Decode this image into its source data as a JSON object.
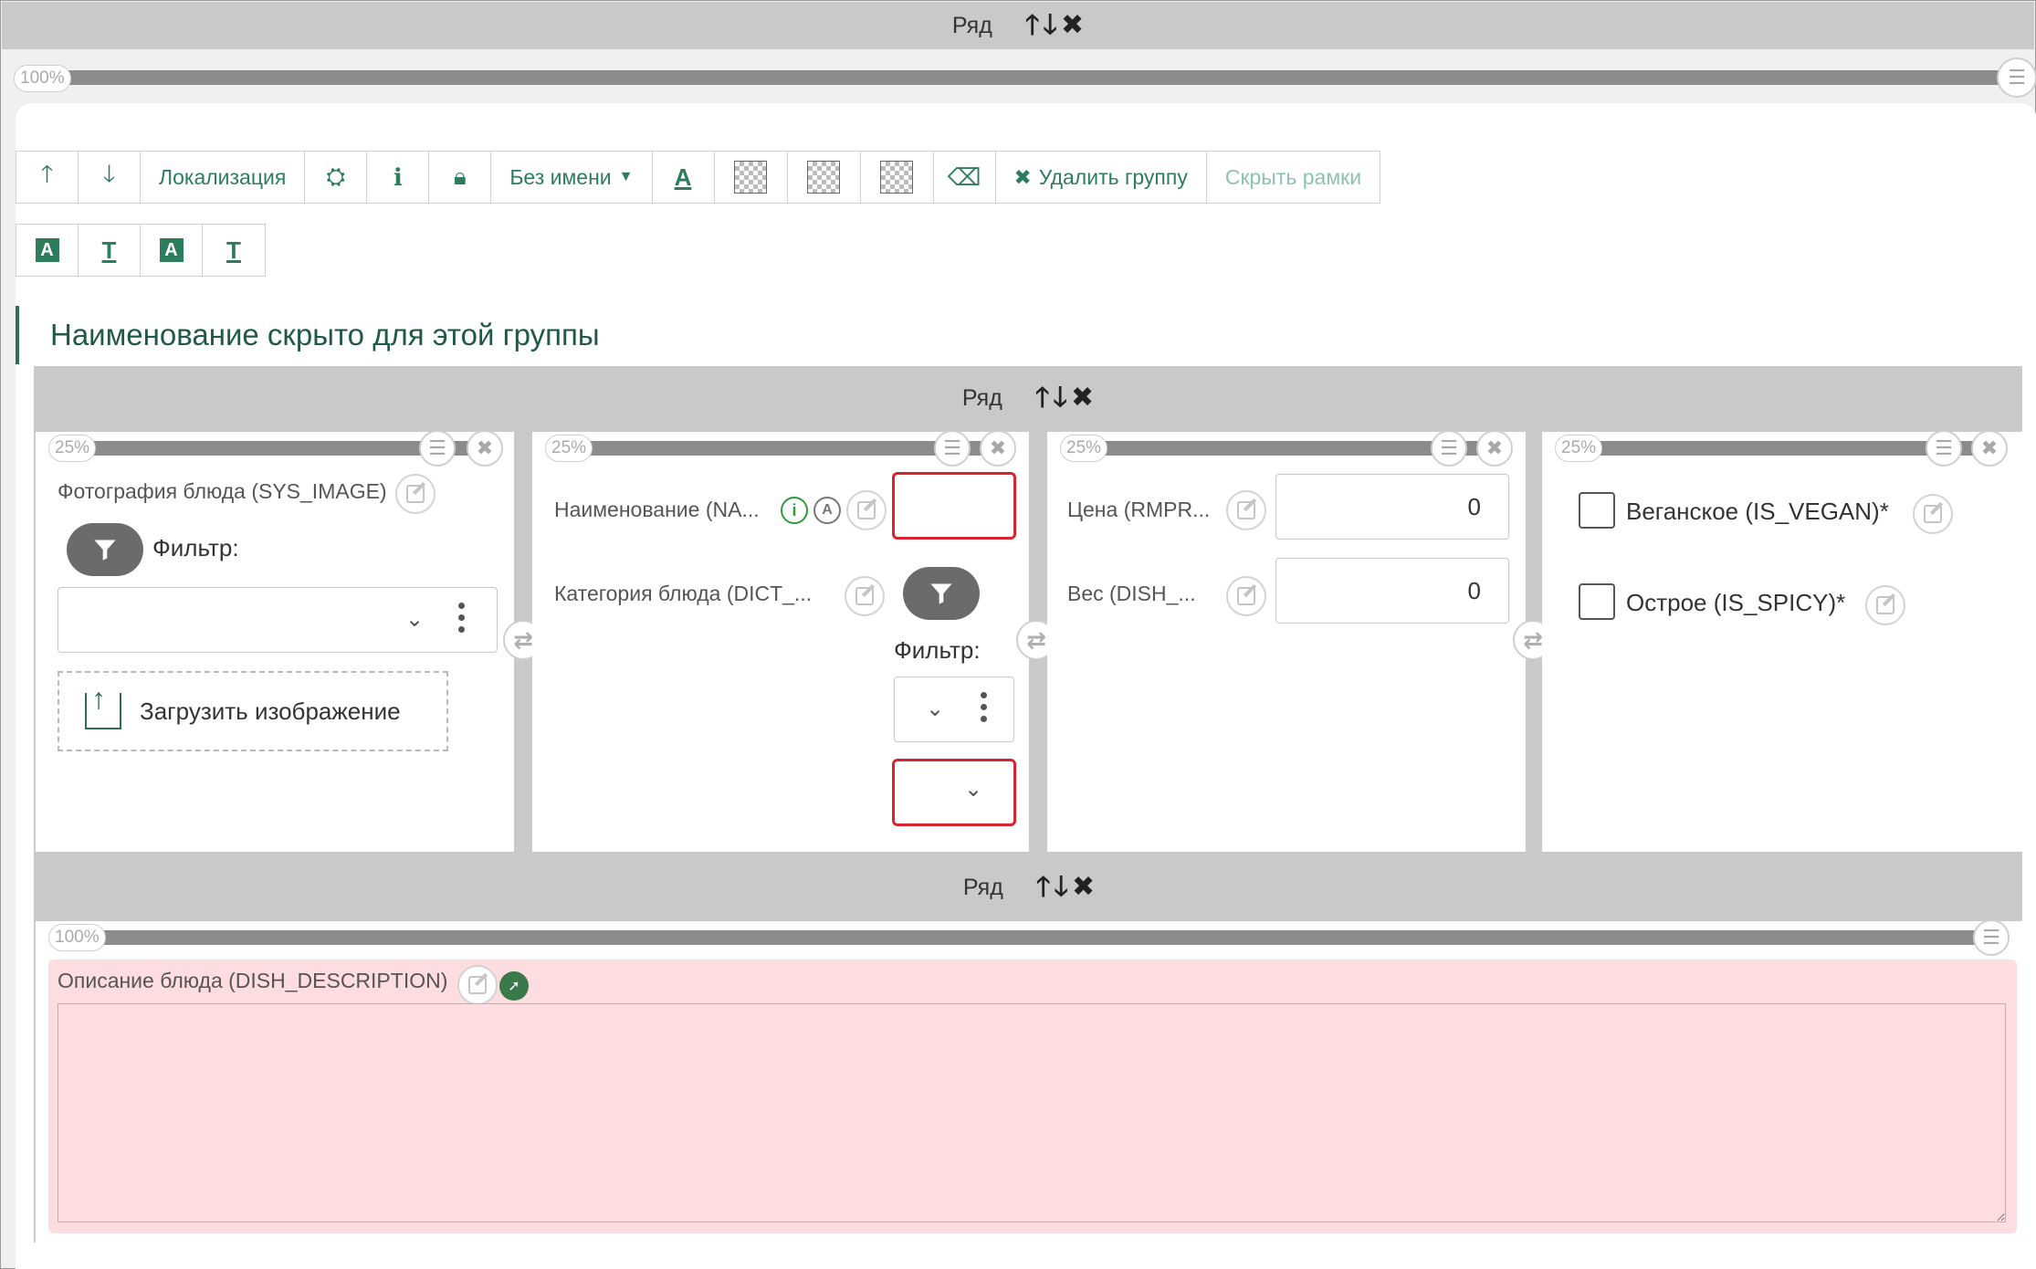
{
  "outer_row": {
    "label": "Ряд",
    "percent": "100%"
  },
  "toolbar": {
    "localization": "Локализация",
    "noname": "Без имени",
    "delete_group": "Удалить группу",
    "hide_frames": "Скрыть рамки"
  },
  "group_title": "Наименование скрыто для этой группы",
  "inner_row": {
    "label": "Ряд"
  },
  "columns": [
    {
      "percent": "25%"
    },
    {
      "percent": "25%"
    },
    {
      "percent": "25%"
    },
    {
      "percent": "25%"
    }
  ],
  "col1": {
    "photo_label": "Фотография блюда (SYS_IMAGE)",
    "filter_label": "Фильтр:",
    "upload_label": "Загрузить изображение"
  },
  "col2": {
    "name_label": "Наименование (NA...",
    "category_label": "Категория блюда (DICT_...",
    "filter_label": "Фильтр:"
  },
  "col3": {
    "price_label": "Цена (RMPR...",
    "price_value": "0",
    "weight_label": "Вес (DISH_...",
    "weight_value": "0"
  },
  "col4": {
    "vegan_label": "Веганское (IS_VEGAN)*",
    "vegan_checked": false,
    "spicy_label": "Острое (IS_SPICY)*",
    "spicy_checked": false
  },
  "bottom_row": {
    "label": "Ряд",
    "percent": "100%"
  },
  "description": {
    "label": "Описание блюда (DISH_DESCRIPTION)",
    "value": ""
  },
  "colors": {
    "accent": "#2d7d5c",
    "required_border": "#d8242e",
    "error_bg": "#fddde0",
    "row_gray": "#c9c9c9"
  }
}
